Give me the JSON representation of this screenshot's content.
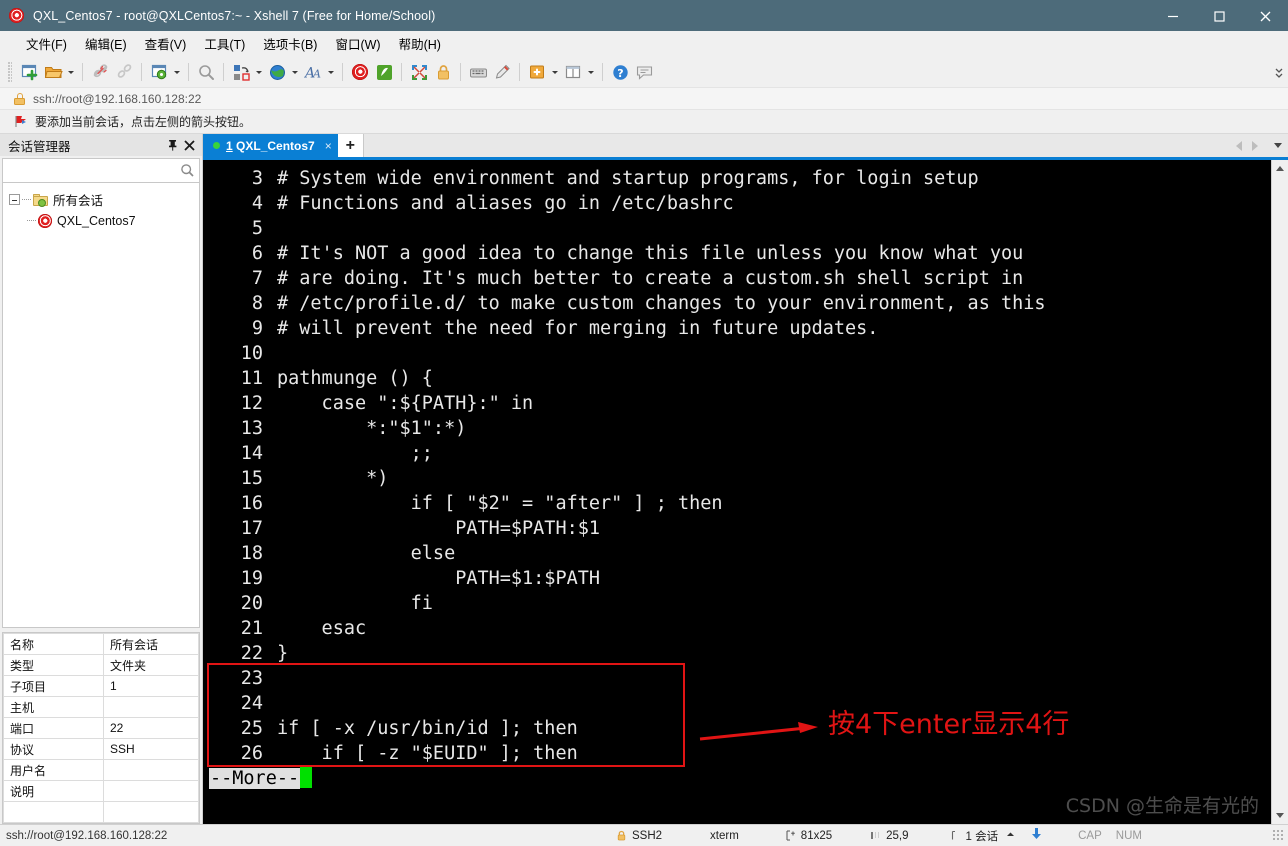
{
  "window": {
    "title": "QXL_Centos7 - root@QXLCentos7:~ - Xshell 7 (Free for Home/School)",
    "app_icon": "xshell-spiral-icon",
    "minimize_label": "–",
    "maximize_label": "□",
    "close_label": "✕"
  },
  "menubar": {
    "items": [
      {
        "label": "文件(F)"
      },
      {
        "label": "编辑(E)"
      },
      {
        "label": "查看(V)"
      },
      {
        "label": "工具(T)"
      },
      {
        "label": "选项卡(B)"
      },
      {
        "label": "窗口(W)"
      },
      {
        "label": "帮助(H)"
      }
    ]
  },
  "toolbar": {
    "buttons": [
      {
        "name": "new-session-icon",
        "dropdown": false
      },
      {
        "name": "open-folder-icon",
        "dropdown": true
      },
      {
        "name": "disconnect-icon",
        "dropdown": false
      },
      {
        "name": "reconnect-icon",
        "dropdown": false
      },
      {
        "name": "session-properties-icon",
        "dropdown": true
      },
      {
        "name": "find-icon",
        "dropdown": false
      },
      {
        "name": "layout-icon",
        "dropdown": true
      },
      {
        "name": "globe-icon",
        "dropdown": true
      },
      {
        "name": "font-icon",
        "dropdown": true
      },
      {
        "name": "xshell-spiral-icon",
        "dropdown": false
      },
      {
        "name": "xftp-icon",
        "dropdown": false
      },
      {
        "name": "fullscreen-icon",
        "dropdown": false
      },
      {
        "name": "lock-icon",
        "dropdown": false
      },
      {
        "name": "keyboard-icon",
        "dropdown": false
      },
      {
        "name": "highlight-icon",
        "dropdown": false
      },
      {
        "name": "add-note-icon",
        "dropdown": true
      },
      {
        "name": "panel-layout-icon",
        "dropdown": true
      },
      {
        "name": "help-icon",
        "dropdown": false
      },
      {
        "name": "feedback-icon",
        "dropdown": false
      }
    ]
  },
  "address_bar": {
    "icon": "lock-icon",
    "url": "ssh://root@192.168.160.128:22"
  },
  "notice_bar": {
    "icon": "red-flag-icon",
    "text": "要添加当前会话，点击左侧的箭头按钮。"
  },
  "sidebar": {
    "title": "会话管理器",
    "pin_icon": "pin-icon",
    "close_icon": "close-icon",
    "search_placeholder": "",
    "search_value": "",
    "tree": [
      {
        "label": "所有会话",
        "icon": "folder-icon",
        "level": 0
      },
      {
        "label": "QXL_Centos7",
        "icon": "xshell-spiral-icon",
        "level": 1
      }
    ],
    "properties": [
      {
        "key": "名称",
        "value": "所有会话"
      },
      {
        "key": "类型",
        "value": "文件夹"
      },
      {
        "key": "子项目",
        "value": "1"
      },
      {
        "key": "主机",
        "value": ""
      },
      {
        "key": "端口",
        "value": "22"
      },
      {
        "key": "协议",
        "value": "SSH"
      },
      {
        "key": "用户名",
        "value": ""
      },
      {
        "key": "说明",
        "value": ""
      },
      {
        "key": "",
        "value": ""
      }
    ]
  },
  "tabbar": {
    "tabs": [
      {
        "index": "1",
        "label": "QXL_Centos7",
        "close_label": "×",
        "status_dot_color": "#39d43b",
        "active": true
      }
    ],
    "new_tab_label": "+",
    "scroll_left_icon": "triangle-left-icon",
    "scroll_right_icon": "triangle-right-icon",
    "tab_menu_icon": "chevron-down-icon"
  },
  "terminal": {
    "lines": [
      {
        "no": "3",
        "text": "# System wide environment and startup programs, for login setup"
      },
      {
        "no": "4",
        "text": "# Functions and aliases go in /etc/bashrc"
      },
      {
        "no": "5",
        "text": ""
      },
      {
        "no": "6",
        "text": "# It's NOT a good idea to change this file unless you know what you"
      },
      {
        "no": "7",
        "text": "# are doing. It's much better to create a custom.sh shell script in"
      },
      {
        "no": "8",
        "text": "# /etc/profile.d/ to make custom changes to your environment, as this"
      },
      {
        "no": "9",
        "text": "# will prevent the need for merging in future updates."
      },
      {
        "no": "10",
        "text": ""
      },
      {
        "no": "11",
        "text": "pathmunge () {"
      },
      {
        "no": "12",
        "text": "    case \":${PATH}:\" in"
      },
      {
        "no": "13",
        "text": "        *:\"$1\":*)"
      },
      {
        "no": "14",
        "text": "            ;;"
      },
      {
        "no": "15",
        "text": "        *)"
      },
      {
        "no": "16",
        "text": "            if [ \"$2\" = \"after\" ] ; then"
      },
      {
        "no": "17",
        "text": "                PATH=$PATH:$1"
      },
      {
        "no": "18",
        "text": "            else"
      },
      {
        "no": "19",
        "text": "                PATH=$1:$PATH"
      },
      {
        "no": "20",
        "text": "            fi"
      },
      {
        "no": "21",
        "text": "    esac"
      },
      {
        "no": "22",
        "text": "}"
      },
      {
        "no": "23",
        "text": ""
      },
      {
        "no": "24",
        "text": ""
      },
      {
        "no": "25",
        "text": "if [ -x /usr/bin/id ]; then"
      },
      {
        "no": "26",
        "text": "    if [ -z \"$EUID\" ]; then"
      }
    ],
    "prompt": "--More--",
    "cursor": "block-cursor",
    "highlight_box": {
      "color": "#e11414",
      "covers_lines": [
        "23",
        "24",
        "25",
        "26"
      ]
    },
    "annotation": {
      "text": "按4下enter显示4行",
      "color": "#e11414",
      "arrow": "right-arrow"
    },
    "watermark": "CSDN @生命是有光的"
  },
  "statusbar": {
    "connection": "ssh://root@192.168.160.128:22",
    "protocol": "SSH2",
    "term_type": "xterm",
    "size": "81x25",
    "cursor_pos": "25,9",
    "sessions": "1 会话",
    "caps": "CAP",
    "num": "NUM"
  }
}
